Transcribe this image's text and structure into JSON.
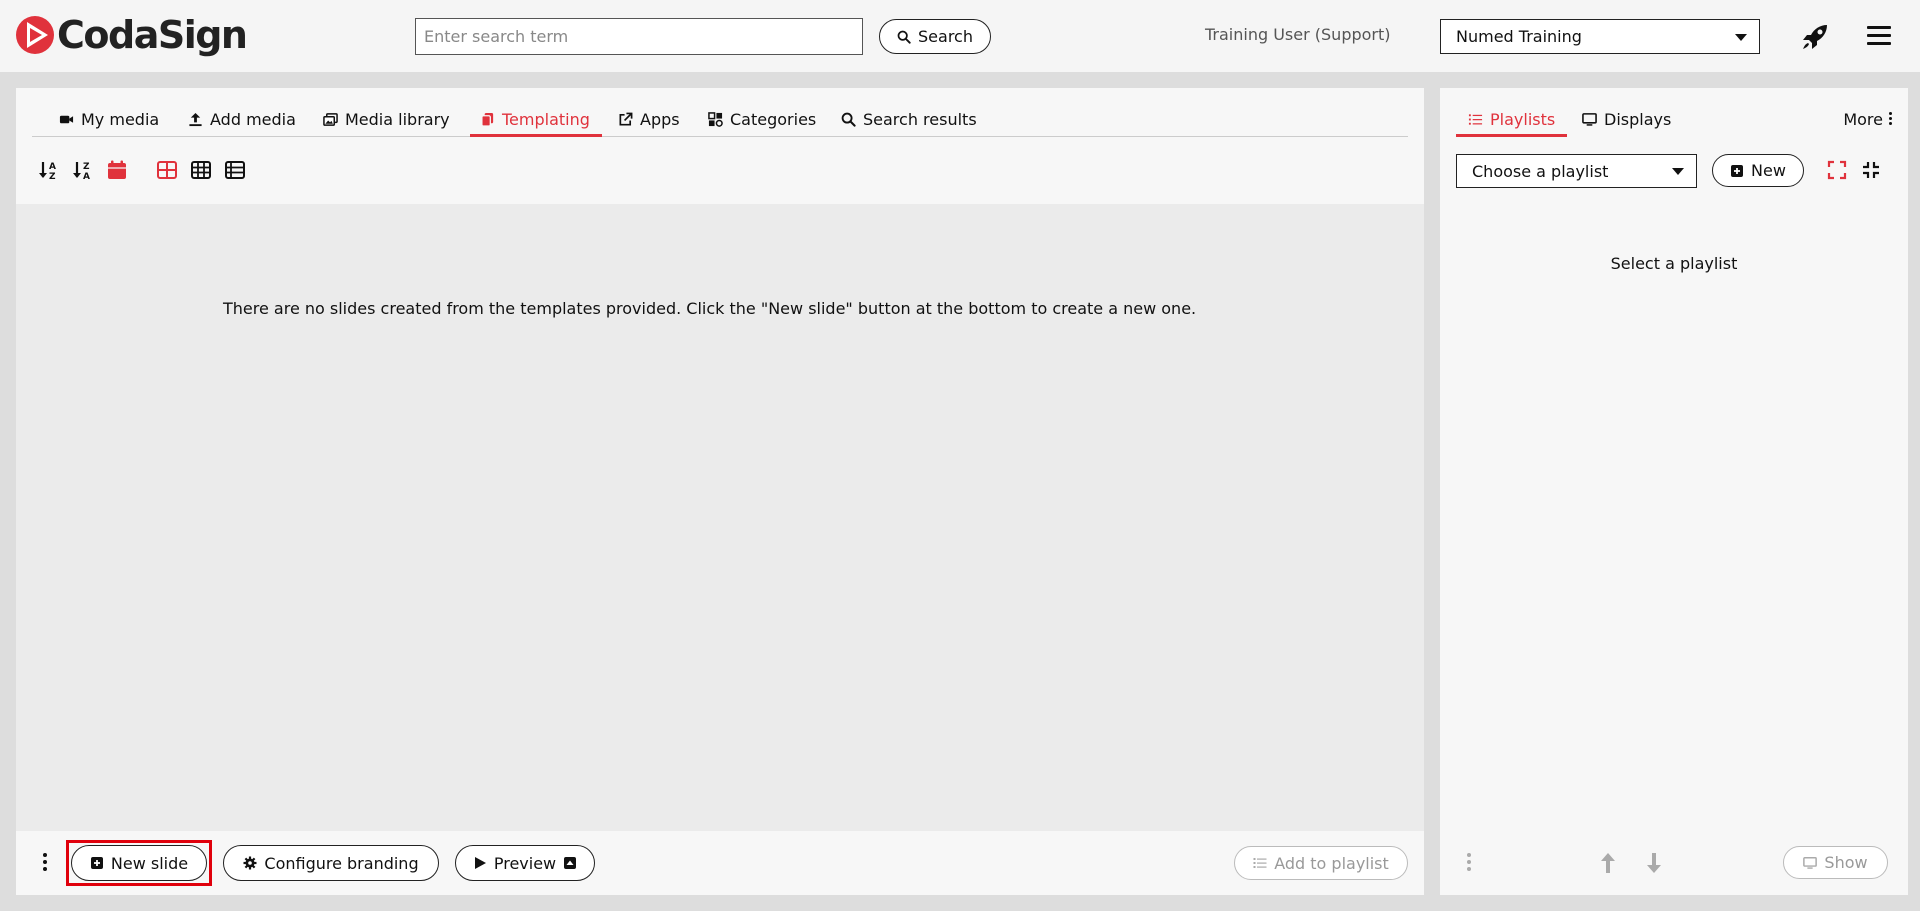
{
  "header": {
    "brand": "CodaSign",
    "search_placeholder": "Enter search term",
    "search_button": "Search",
    "user_label": "Training User (Support)",
    "account_selected": "Numed Training"
  },
  "tabs": [
    {
      "label": "My media",
      "icon": "video-camera-icon"
    },
    {
      "label": "Add media",
      "icon": "upload-icon"
    },
    {
      "label": "Media library",
      "icon": "images-icon"
    },
    {
      "label": "Templating",
      "icon": "copy-icon",
      "active": true
    },
    {
      "label": "Apps",
      "icon": "external-link-icon"
    },
    {
      "label": "Categories",
      "icon": "category-icon"
    },
    {
      "label": "Search results",
      "icon": "search-icon"
    }
  ],
  "main": {
    "empty_message": "There are no slides created from the templates provided. Click the \"New slide\" button at the bottom to create a new one."
  },
  "bottom_bar": {
    "new_slide": "New slide",
    "configure_branding": "Configure branding",
    "preview": "Preview",
    "add_to_playlist": "Add to playlist"
  },
  "right_panel": {
    "tabs": [
      {
        "label": "Playlists",
        "active": true,
        "icon": "list-icon"
      },
      {
        "label": "Displays",
        "icon": "monitor-icon"
      }
    ],
    "more": "More",
    "playlist_select": "Choose a playlist",
    "new_button": "New",
    "empty_message": "Select a playlist",
    "show_button": "Show"
  },
  "colors": {
    "accent": "#e0323c",
    "highlight": "#e0000c",
    "panel": "#f7f7f7",
    "content_area": "#ebebeb"
  }
}
